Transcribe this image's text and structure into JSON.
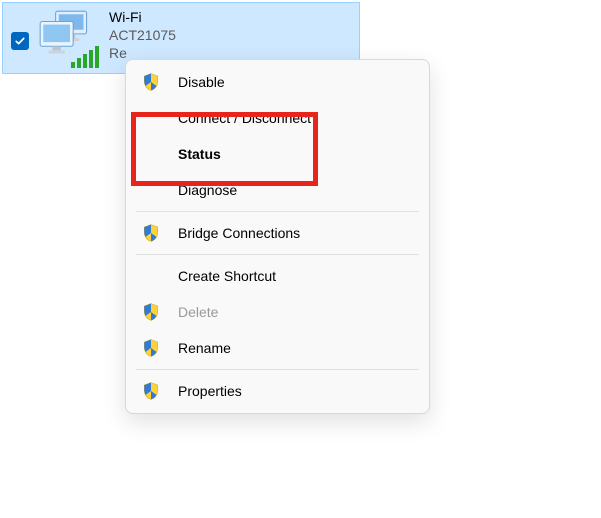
{
  "adapter": {
    "name": "Wi-Fi",
    "ssid": "ACT21075",
    "vendor": "Re",
    "checked": true
  },
  "menu": {
    "items": [
      {
        "label": "Disable",
        "shield": true
      },
      {
        "label": "Connect / Disconnect",
        "shield": false
      },
      {
        "label": "Status",
        "shield": false,
        "bold": true
      },
      {
        "label": "Diagnose",
        "shield": false
      }
    ],
    "group2": [
      {
        "label": "Bridge Connections",
        "shield": true
      }
    ],
    "group3": [
      {
        "label": "Create Shortcut",
        "shield": false
      },
      {
        "label": "Delete",
        "shield": true,
        "disabled": true
      },
      {
        "label": "Rename",
        "shield": true
      }
    ],
    "group4": [
      {
        "label": "Properties",
        "shield": true
      }
    ]
  }
}
